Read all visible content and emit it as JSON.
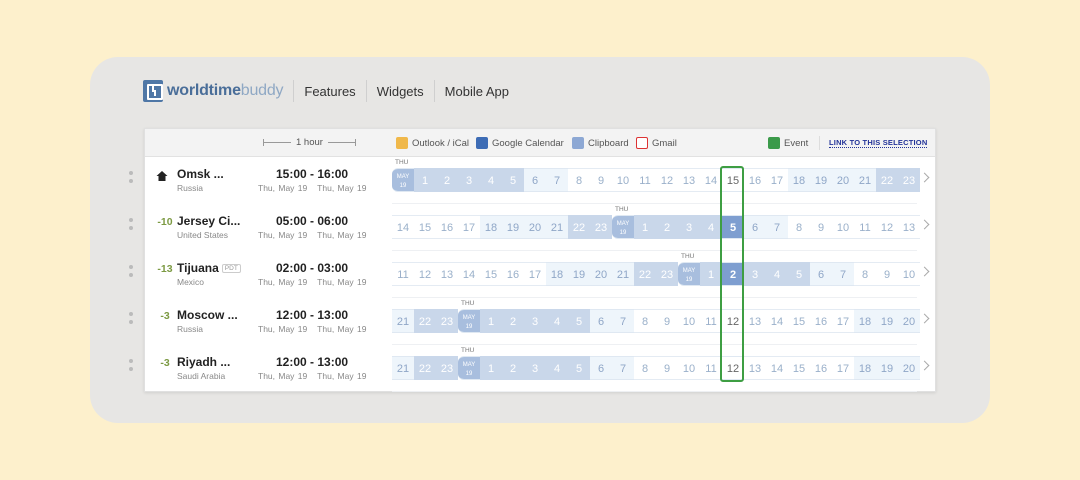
{
  "nav": {
    "logo_part1": "worldtime",
    "logo_part2": "buddy",
    "links": [
      "Features",
      "Widgets",
      "Mobile App"
    ]
  },
  "toolbar": {
    "one_hour": "1 hour",
    "outlook": "Outlook / iCal",
    "gcal": "Google Calendar",
    "clipboard": "Clipboard",
    "gmail": "Gmail",
    "event": "Event",
    "link": "LINK TO THIS SELECTION"
  },
  "rows": [
    {
      "offset": "",
      "city": "Omsk ...",
      "badge": "",
      "country": "Russia",
      "time": "15:00 - 16:00",
      "dates": "Thu, May 19   Thu, May 19",
      "day_label": "THU",
      "hours": [
        "MAY\n19",
        "1",
        "2",
        "3",
        "4",
        "5",
        "6",
        "7",
        "8",
        "9",
        "10",
        "11",
        "12",
        "13",
        "14",
        "15",
        "16",
        "17",
        "18",
        "19",
        "20",
        "21",
        "22",
        "23"
      ]
    },
    {
      "offset": "-10",
      "city": "Jersey Ci...",
      "badge": "",
      "country": "United States",
      "time": "05:00 - 06:00",
      "dates": "Thu, May 19   Thu, May 19",
      "day_label": "THU",
      "hours": [
        "14",
        "15",
        "16",
        "17",
        "18",
        "19",
        "20",
        "21",
        "22",
        "23",
        "MAY\n19",
        "1",
        "2",
        "3",
        "4",
        "5",
        "6",
        "7",
        "8",
        "9",
        "10",
        "11",
        "12",
        "13"
      ]
    },
    {
      "offset": "-13",
      "city": "Tijuana",
      "badge": "PDT",
      "country": "Mexico",
      "time": "02:00 - 03:00",
      "dates": "Thu, May 19   Thu, May 19",
      "day_label": "THU",
      "hours": [
        "11",
        "12",
        "13",
        "14",
        "15",
        "16",
        "17",
        "18",
        "19",
        "20",
        "21",
        "22",
        "23",
        "MAY\n19",
        "1",
        "2",
        "3",
        "4",
        "5",
        "6",
        "7",
        "8",
        "9",
        "10"
      ]
    },
    {
      "offset": "-3",
      "city": "Moscow ...",
      "badge": "",
      "country": "Russia",
      "time": "12:00 - 13:00",
      "dates": "Thu, May 19   Thu, May 19",
      "day_label": "THU",
      "hours": [
        "21",
        "22",
        "23",
        "MAY\n19",
        "1",
        "2",
        "3",
        "4",
        "5",
        "6",
        "7",
        "8",
        "9",
        "10",
        "11",
        "12",
        "13",
        "14",
        "15",
        "16",
        "17",
        "18",
        "19",
        "20"
      ]
    },
    {
      "offset": "-3",
      "city": "Riyadh ...",
      "badge": "",
      "country": "Saudi Arabia",
      "time": "12:00 - 13:00",
      "dates": "Thu, May 19   Thu, May 19",
      "day_label": "THU",
      "hours": [
        "21",
        "22",
        "23",
        "MAY\n19",
        "1",
        "2",
        "3",
        "4",
        "5",
        "6",
        "7",
        "8",
        "9",
        "10",
        "11",
        "12",
        "13",
        "14",
        "15",
        "16",
        "17",
        "18",
        "19",
        "20"
      ]
    }
  ],
  "selected_column_index": 15,
  "colors": {
    "accent": "#4f77a6",
    "highlight": "#3e9e43",
    "offset_text": "#7c9a43"
  }
}
